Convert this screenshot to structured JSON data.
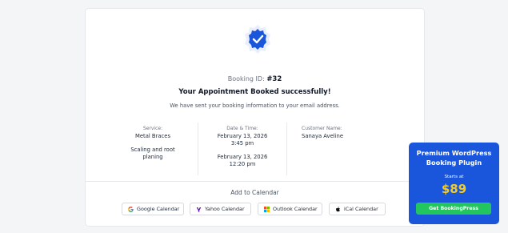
{
  "confirmation": {
    "booking_id_label": "Booking ID:",
    "booking_id": "#32",
    "title": "Your Appointment Booked successfully!",
    "subtitle": "We have sent your booking information to your email address."
  },
  "details": {
    "service_label": "Service:",
    "services": [
      "Metal Braces",
      "Scaling and root planing"
    ],
    "datetime_label": "Date & Time:",
    "datetimes": [
      {
        "date": "February 13, 2026",
        "time": "3:45 pm"
      },
      {
        "date": "February 13, 2026",
        "time": "12:20 pm"
      }
    ],
    "customer_label": "Customer Name:",
    "customer_name": "Sanaya Aveline"
  },
  "calendar": {
    "heading": "Add to Calendar",
    "buttons": [
      {
        "label": "Google Calendar",
        "icon": "google-icon"
      },
      {
        "label": "Yahoo Calendar",
        "icon": "yahoo-icon"
      },
      {
        "label": "Outlook Calendar",
        "icon": "outlook-icon"
      },
      {
        "label": "iCal Calendar",
        "icon": "apple-icon"
      }
    ]
  },
  "promo": {
    "title_line1": "Premium WordPress",
    "title_line2": "Booking Plugin",
    "starts_at": "Starts at",
    "price": "$89",
    "cta": "Get BookingPress"
  },
  "colors": {
    "accent": "#1a56db",
    "price": "#facc15",
    "cta": "#22c55e"
  }
}
